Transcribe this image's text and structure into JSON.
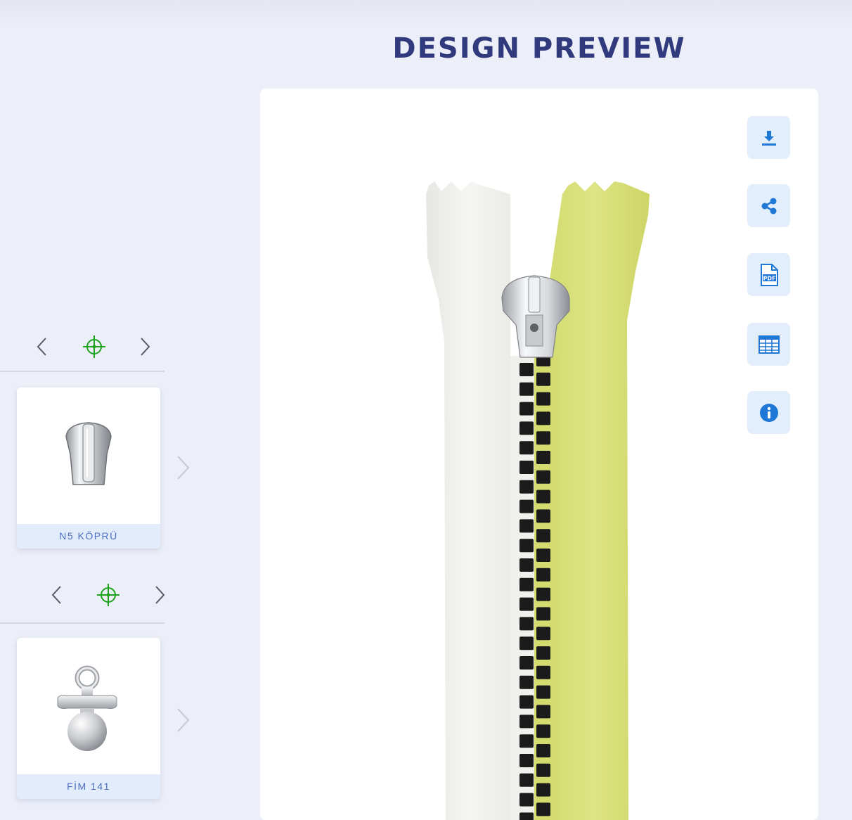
{
  "page": {
    "title": "DESIGN PREVIEW"
  },
  "colors": {
    "title": "#323a7e",
    "accent_green": "#1fa31f",
    "action_blue": "#1f77d6",
    "card_label_bg": "#e2ecfb",
    "card_label_text": "#4c6fc4",
    "tape_left": "#f3f3f0",
    "tape_right": "#d8e07c",
    "teeth": "#1b1b1b"
  },
  "left_panel": {
    "sections": [
      {
        "nav": {
          "prev_icon": "chevron-left-icon",
          "focus_icon": "crosshair-icon",
          "next_icon": "chevron-right-icon"
        },
        "item": {
          "label": "N5 KÖPRÜ",
          "image": "zipper-slider-bridge"
        },
        "next_icon": "chevron-right-icon"
      },
      {
        "nav": {
          "prev_icon": "chevron-left-icon",
          "focus_icon": "crosshair-icon",
          "next_icon": "chevron-right-icon"
        },
        "item": {
          "label": "FİM 141",
          "image": "pacifier-puller"
        },
        "next_icon": "chevron-right-icon"
      }
    ]
  },
  "preview": {
    "product_image": "zipper-preview",
    "actions": [
      {
        "name": "download",
        "icon": "download-icon"
      },
      {
        "name": "share",
        "icon": "share-icon"
      },
      {
        "name": "pdf",
        "icon": "pdf-file-icon",
        "icon_text": "PDF"
      },
      {
        "name": "spreadsheet",
        "icon": "spreadsheet-icon"
      },
      {
        "name": "info",
        "icon": "info-icon"
      }
    ]
  }
}
